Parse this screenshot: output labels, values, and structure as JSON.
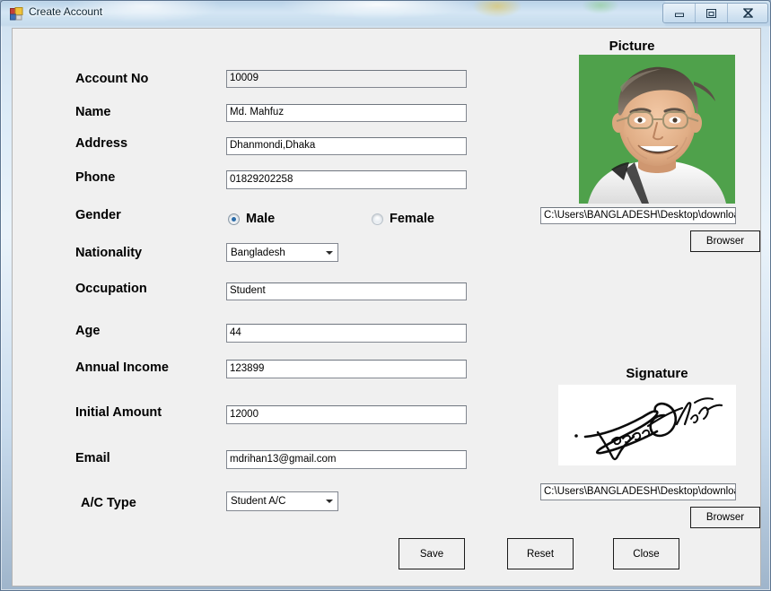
{
  "window": {
    "title": "Create Account",
    "controls": {
      "minimize": "minimize-button",
      "maximize": "maximize-button",
      "close": "close-button"
    }
  },
  "form": {
    "fields": [
      {
        "label": "Account No",
        "value": "10009",
        "type": "textbox",
        "readonly": true
      },
      {
        "label": "Name",
        "value": "Md. Mahfuz",
        "type": "textbox",
        "readonly": false
      },
      {
        "label": "Address",
        "value": "Dhanmondi,Dhaka",
        "type": "textbox",
        "readonly": false
      },
      {
        "label": "Phone",
        "value": "01829202258",
        "type": "textbox",
        "readonly": false
      },
      {
        "label": "Gender",
        "value": "Male",
        "type": "radiogroup"
      },
      {
        "label": "Nationality",
        "value": "Bangladesh",
        "type": "combobox"
      },
      {
        "label": "Occupation",
        "value": "Student",
        "type": "textbox",
        "readonly": false
      },
      {
        "label": "Age",
        "value": "44",
        "type": "textbox",
        "readonly": false
      },
      {
        "label": "Annual Income",
        "value": "123899",
        "type": "textbox",
        "readonly": false
      },
      {
        "label": "Initial Amount",
        "value": "12000",
        "type": "textbox",
        "readonly": false
      },
      {
        "label": "Email",
        "value": "mdrihan13@gmail.com",
        "type": "textbox",
        "readonly": false
      },
      {
        "label": "A/C Type",
        "value": "Student A/C",
        "type": "combobox"
      }
    ],
    "gender": {
      "label": "Gender",
      "options": [
        {
          "label": "Male",
          "selected": true
        },
        {
          "label": "Female",
          "selected": false
        }
      ]
    }
  },
  "picture": {
    "heading": "Picture",
    "path": "C:\\Users\\BANGLADESH\\Desktop\\downloa",
    "browse_label": "Browser"
  },
  "signature": {
    "heading": "Signature",
    "path": "C:\\Users\\BANGLADESH\\Desktop\\downloa",
    "browse_label": "Browser"
  },
  "actions": [
    {
      "label": "Save"
    },
    {
      "label": "Reset"
    },
    {
      "label": "Close"
    }
  ],
  "colors": {
    "form_background": "#f0f0f0",
    "field_background": "#ffffff",
    "radio_accent": "#2c6ca8",
    "picture_backdrop": "#4fa14b",
    "title_text": "#0c2331"
  }
}
